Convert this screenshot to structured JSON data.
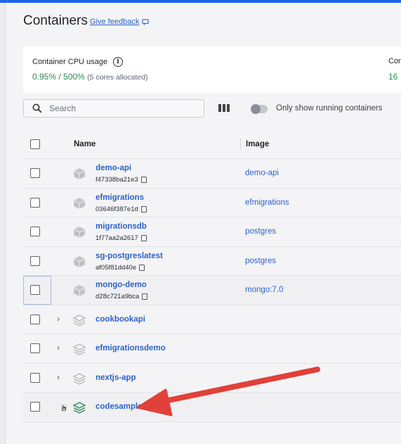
{
  "header": {
    "title": "Containers",
    "feedback_label": "Give feedback"
  },
  "stats": {
    "cpu_label": "Container CPU usage",
    "cpu_value": "0.95% / 500%",
    "cpu_sub": "(5 cores allocated)",
    "mem_label": "Con",
    "mem_value": "16"
  },
  "toolbar": {
    "search_placeholder": "Search",
    "toggle_label": "Only show running containers"
  },
  "table": {
    "columns": {
      "name": "Name",
      "image": "Image"
    },
    "rows": [
      {
        "name": "demo-api",
        "id": "f47338ba21e3",
        "image": "demo-api"
      },
      {
        "name": "efmigrations",
        "id": "03646f387e1d",
        "image": "efmigrations"
      },
      {
        "name": "migrationsdb",
        "id": "1f77aa2a2617",
        "image": "postgres"
      },
      {
        "name": "sg-postgreslatest",
        "id": "af05f81dd40e",
        "image": "postgres"
      },
      {
        "name": "mongo-demo",
        "id": "d28c721a9bca",
        "image": "mongo:7.0"
      }
    ],
    "groups": [
      {
        "name": "cookbookapi"
      },
      {
        "name": "efmigrationsdemo"
      },
      {
        "name": "nextjs-app"
      },
      {
        "name": "codesamples"
      }
    ]
  },
  "colors": {
    "accent": "#1d63ed",
    "link": "#2d63c8",
    "green": "#2e8b57",
    "arrow": "#e0413a"
  }
}
